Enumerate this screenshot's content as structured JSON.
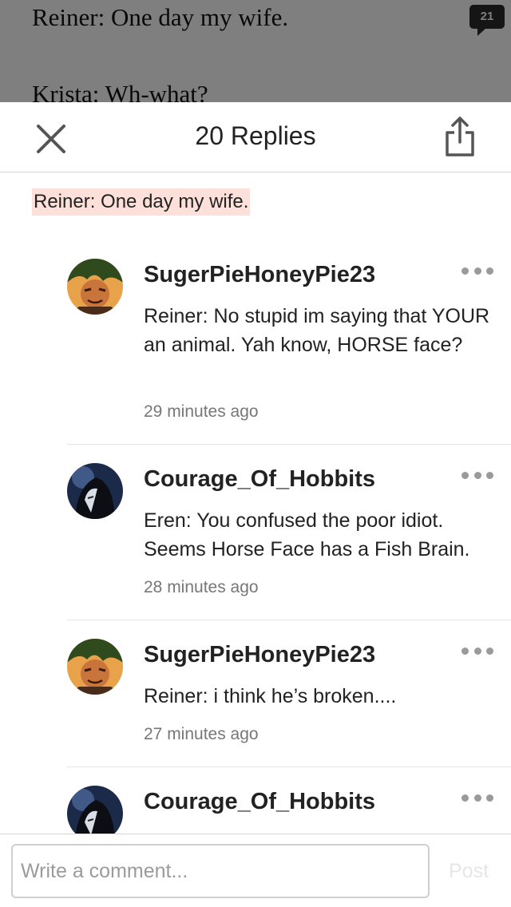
{
  "story": {
    "line1": "Reiner: One day my wife.",
    "line2": "Krista: Wh-what?",
    "comment_count": "21"
  },
  "header": {
    "title": "20 Replies"
  },
  "quote": "Reiner: One day my wife.",
  "replies": [
    {
      "username": "SugerPieHoneyPie23",
      "body": "Reiner: No stupid im saying that YOUR an animal. Yah know, HORSE face?",
      "time": "29 minutes ago",
      "avatar": "avatar-green-hair"
    },
    {
      "username": "Courage_Of_Hobbits",
      "body": "Eren: You confused the poor idiot. Seems Horse Face has a Fish Brain.",
      "time": "28 minutes ago",
      "avatar": "avatar-dark-hair"
    },
    {
      "username": "SugerPieHoneyPie23",
      "body": "Reiner: i think he’s broken....",
      "time": "27 minutes ago",
      "avatar": "avatar-green-hair"
    },
    {
      "username": "Courage_Of_Hobbits",
      "body": "",
      "time": "",
      "avatar": "avatar-dark-hair"
    }
  ],
  "composer": {
    "placeholder": "Write a comment...",
    "post_label": "Post"
  },
  "colors": {
    "quote_highlight": "#fde0d9",
    "muted_text": "#777777"
  }
}
